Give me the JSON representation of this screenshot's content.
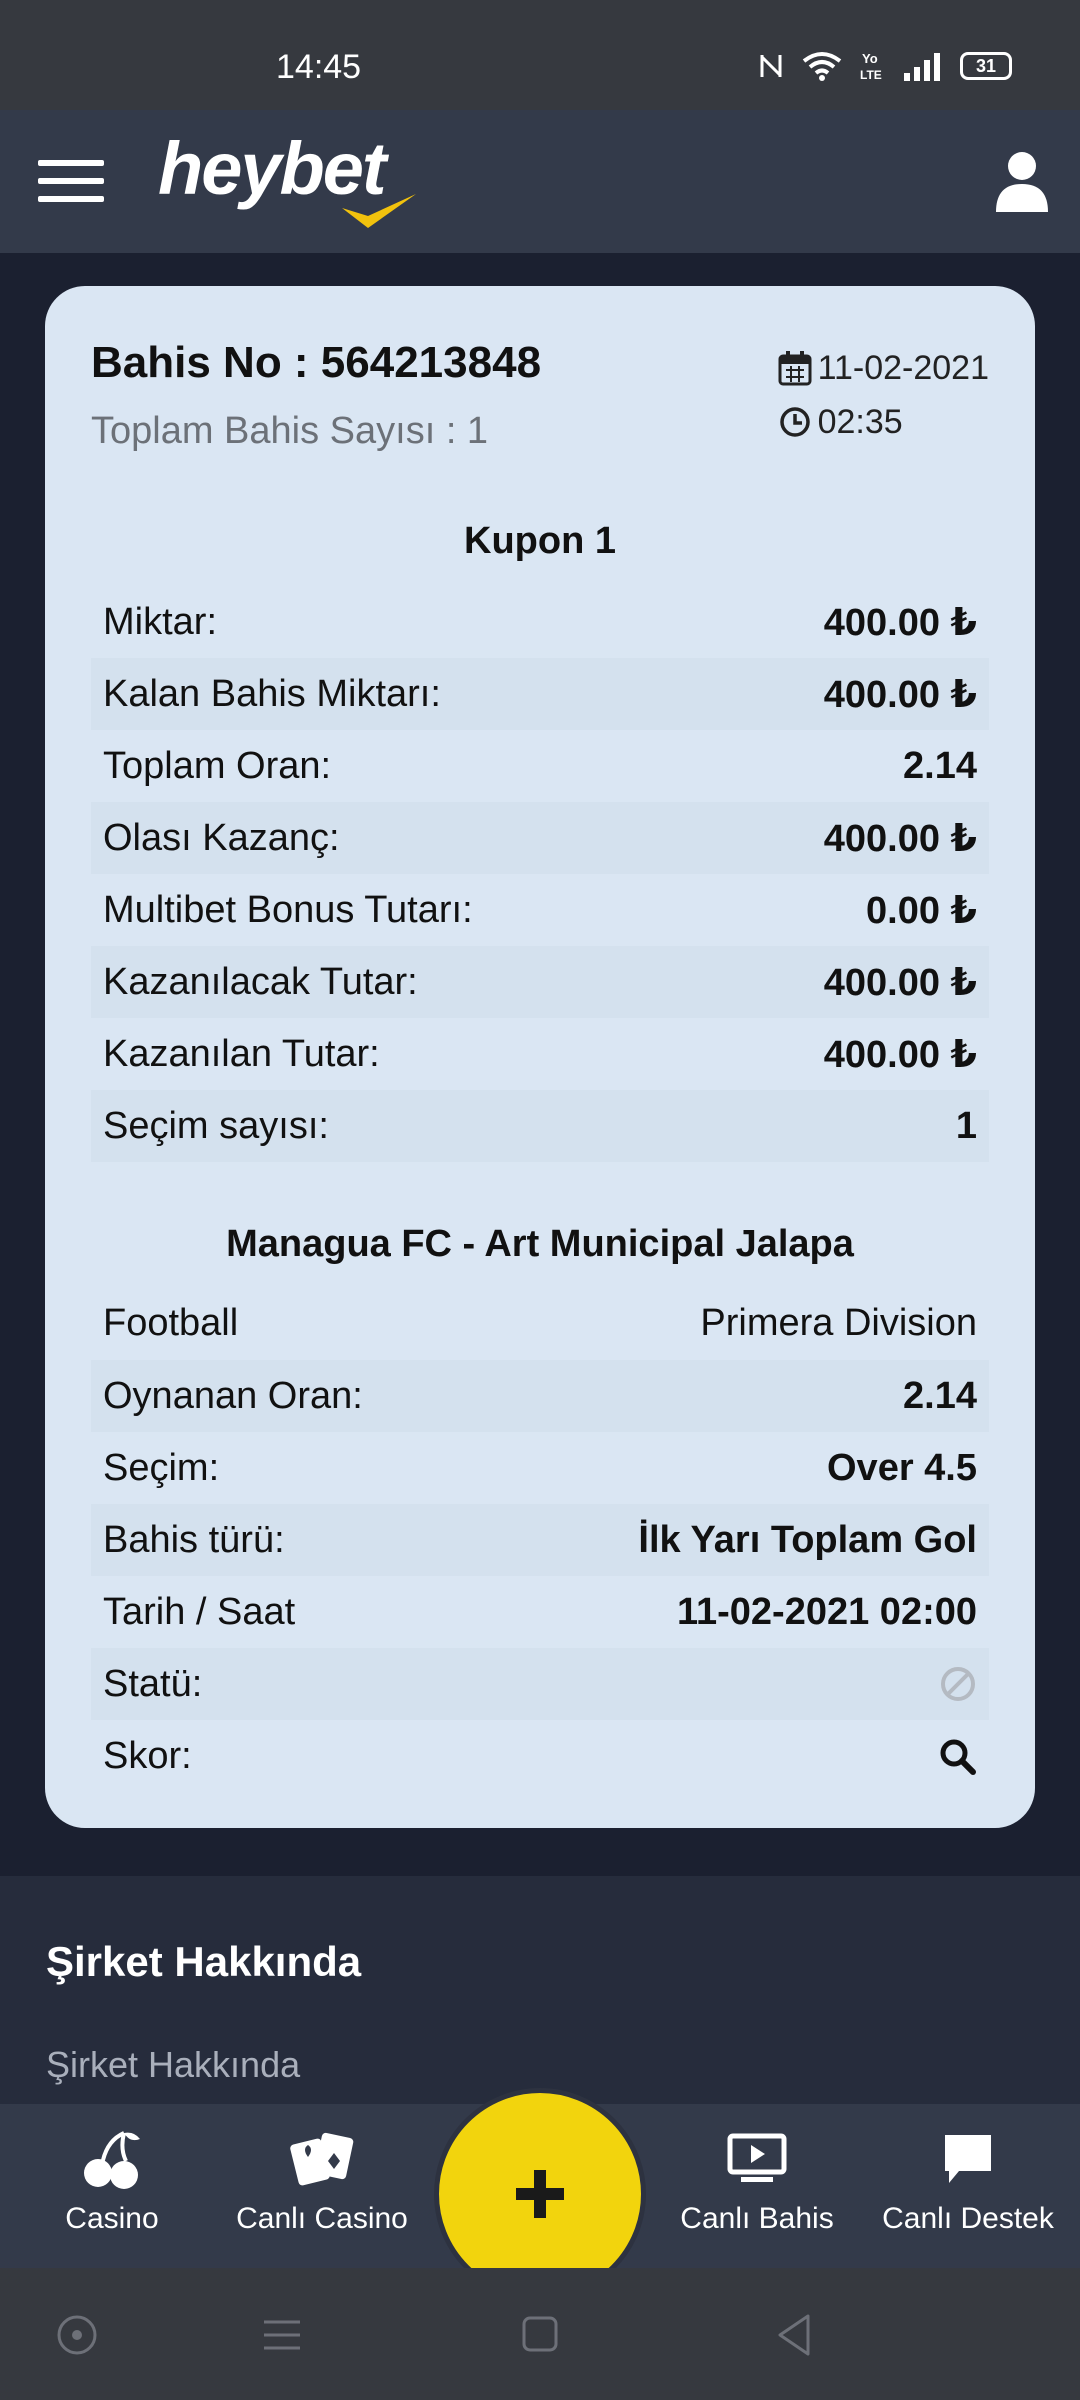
{
  "status_bar": {
    "time": "14:45",
    "battery": "31"
  },
  "header": {
    "logo": "heybet"
  },
  "ticket": {
    "bet_number": "Bahis No : 564213848",
    "total_bets": "Toplam Bahis Sayısı : 1",
    "date": "11-02-2021",
    "time": "02:35",
    "coupon_title": "Kupon 1",
    "coupon_rows": [
      {
        "label": "Miktar:",
        "value": "400.00 ₺"
      },
      {
        "label": "Kalan Bahis Miktarı:",
        "value": "400.00 ₺"
      },
      {
        "label": "Toplam Oran:",
        "value": "2.14"
      },
      {
        "label": "Olası Kazanç:",
        "value": "400.00 ₺"
      },
      {
        "label": "Multibet Bonus Tutarı:",
        "value": "0.00 ₺"
      },
      {
        "label": "Kazanılacak Tutar:",
        "value": "400.00 ₺"
      },
      {
        "label": "Kazanılan Tutar:",
        "value": "400.00 ₺"
      },
      {
        "label": "Seçim sayısı:",
        "value": "1"
      }
    ],
    "match_title": "Managua FC - Art Municipal Jalapa",
    "match_rows": [
      {
        "label": "Football",
        "value": "Primera Division"
      },
      {
        "label": "Oynanan Oran:",
        "value": "2.14"
      },
      {
        "label": "Seçim:",
        "value": "Over 4.5"
      },
      {
        "label": "Bahis türü:",
        "value": "İlk Yarı Toplam Gol"
      },
      {
        "label": "Tarih / Saat",
        "value": "11-02-2021 02:00"
      },
      {
        "label": "Statü:",
        "icon": "ban-icon"
      },
      {
        "label": "Skor:",
        "icon": "search-icon"
      }
    ]
  },
  "footer": {
    "title": "Şirket Hakkında",
    "link": "Şirket Hakkında"
  },
  "bottom_nav": {
    "items": [
      {
        "label": "Casino",
        "icon": "cherry-icon"
      },
      {
        "label": "Canlı Casino",
        "icon": "cards-icon"
      },
      {
        "label": "Canlı Bahis",
        "icon": "tv-play-icon"
      },
      {
        "label": "Canlı Destek",
        "icon": "chat-icon"
      }
    ],
    "fab_icon": "plus-icon"
  },
  "colors": {
    "card_bg": "#dae6f3",
    "header_bg": "#333a4a",
    "fab": "#f2d40d",
    "logo_accent": "#f2c20d"
  }
}
